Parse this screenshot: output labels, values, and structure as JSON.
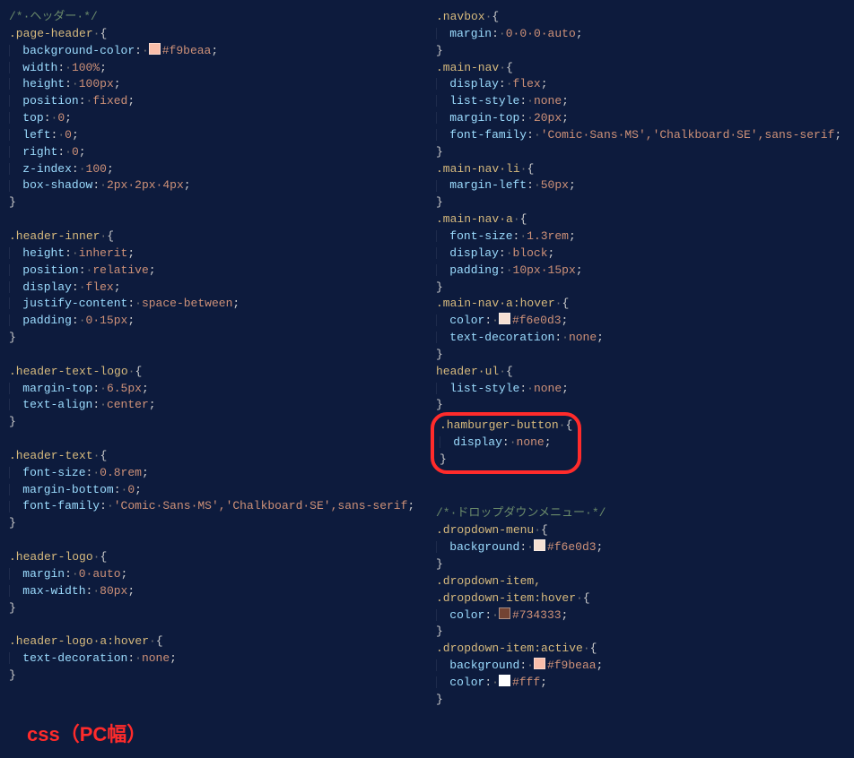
{
  "label": "css（PC幅）",
  "col1": {
    "comment": "/*·ヘッダー·*/",
    "blocks": [
      {
        "selector": ".page-header",
        "decls": [
          {
            "prop": "background-color",
            "val": "#f9beaa",
            "swatch": "#f9beaa"
          },
          {
            "prop": "width",
            "val": "100%"
          },
          {
            "prop": "height",
            "val": "100px"
          },
          {
            "prop": "position",
            "val": "fixed"
          },
          {
            "prop": "top",
            "val": "0"
          },
          {
            "prop": "left",
            "val": "0"
          },
          {
            "prop": "right",
            "val": "0"
          },
          {
            "prop": "z-index",
            "val": "100"
          },
          {
            "prop": "box-shadow",
            "val": "2px·2px·4px"
          }
        ]
      },
      {
        "selector": ".header-inner",
        "decls": [
          {
            "prop": "height",
            "val": "inherit"
          },
          {
            "prop": "position",
            "val": "relative"
          },
          {
            "prop": "display",
            "val": "flex"
          },
          {
            "prop": "justify-content",
            "val": "space-between"
          },
          {
            "prop": "padding",
            "val": "0·15px"
          }
        ]
      },
      {
        "selector": ".header-text-logo",
        "decls": [
          {
            "prop": "margin-top",
            "val": "6.5px"
          },
          {
            "prop": "text-align",
            "val": "center"
          }
        ]
      },
      {
        "selector": ".header-text",
        "decls": [
          {
            "prop": "font-size",
            "val": "0.8rem"
          },
          {
            "prop": "margin-bottom",
            "val": "0"
          },
          {
            "prop": "font-family",
            "val": "'Comic·Sans·MS','Chalkboard·SE',sans-serif"
          }
        ]
      },
      {
        "selector": ".header-logo",
        "decls": [
          {
            "prop": "margin",
            "val": "0·auto"
          },
          {
            "prop": "max-width",
            "val": "80px"
          }
        ]
      },
      {
        "selector": ".header-logo·a:hover",
        "decls": [
          {
            "prop": "text-decoration",
            "val": "none"
          }
        ]
      }
    ]
  },
  "col2": {
    "blocks_top": [
      {
        "selector": ".navbox",
        "decls": [
          {
            "prop": "margin",
            "val": "0·0·0·auto"
          }
        ]
      },
      {
        "selector": ".main-nav",
        "decls": [
          {
            "prop": "display",
            "val": "flex"
          },
          {
            "prop": "list-style",
            "val": "none"
          },
          {
            "prop": "margin-top",
            "val": "20px"
          },
          {
            "prop": "font-family",
            "val": "'Comic·Sans·MS','Chalkboard·SE',sans-serif"
          }
        ]
      },
      {
        "selector": ".main-nav·li",
        "decls": [
          {
            "prop": "margin-left",
            "val": "50px"
          }
        ]
      },
      {
        "selector": ".main-nav·a",
        "decls": [
          {
            "prop": "font-size",
            "val": "1.3rem"
          },
          {
            "prop": "display",
            "val": "block"
          },
          {
            "prop": "padding",
            "val": "10px·15px"
          }
        ]
      },
      {
        "selector": ".main-nav·a:hover",
        "decls": [
          {
            "prop": "color",
            "val": "#f6e0d3",
            "swatch": "#f6e0d3"
          },
          {
            "prop": "text-decoration",
            "val": "none"
          }
        ]
      },
      {
        "selector": "header·ul",
        "decls": [
          {
            "prop": "list-style",
            "val": "none"
          }
        ]
      }
    ],
    "highlighted": {
      "selector": ".hamburger-button",
      "decls": [
        {
          "prop": "display",
          "val": "none"
        }
      ]
    },
    "comment2": "/*·ドロップダウンメニュー·*/",
    "blocks_bottom": [
      {
        "selector": ".dropdown-menu",
        "decls": [
          {
            "prop": "background",
            "val": "#f6e0d3",
            "swatch": "#f6e0d3"
          }
        ]
      },
      {
        "selector": ".dropdown-item,\n.dropdown-item:hover",
        "decls": [
          {
            "prop": "color",
            "val": "#734333",
            "swatch": "#734333"
          }
        ]
      },
      {
        "selector": ".dropdown-item:active",
        "decls": [
          {
            "prop": "background",
            "val": "#f9beaa",
            "swatch": "#f9beaa"
          },
          {
            "prop": "color",
            "val": "#fff",
            "swatch": "#ffffff"
          }
        ]
      }
    ]
  }
}
